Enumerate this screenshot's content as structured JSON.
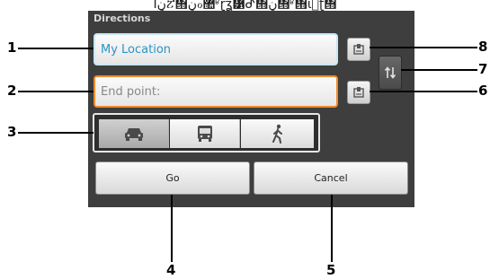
{
  "top_caption": "Ĭ݈ڼ݈ፘ፛͂ڼℴ޺ʶ̈ɽʓ᝱ᕸ፛ڼ፛ʶ፛ιᄌ̈ʈ፛",
  "dialog": {
    "title": "Directions",
    "start_field": {
      "value": "My Location"
    },
    "end_field": {
      "placeholder": "End point:"
    },
    "contact_icon_name": "contact-picker-icon",
    "swap_icon_name": "swap-arrows-icon",
    "transport_modes": [
      {
        "name": "car",
        "icon": "car-icon",
        "selected": true
      },
      {
        "name": "transit",
        "icon": "bus-icon",
        "selected": false
      },
      {
        "name": "walking",
        "icon": "walk-icon",
        "selected": false
      }
    ],
    "go_label": "Go",
    "cancel_label": "Cancel"
  },
  "callouts": {
    "c1": "1",
    "c2": "2",
    "c3": "3",
    "c4": "4",
    "c5": "5",
    "c6": "6",
    "c7": "7",
    "c8": "8"
  },
  "colors": {
    "panel": "#3e3e3e",
    "start_border": "#c9e7f4",
    "start_text": "#2a94c6",
    "end_border": "#f08b2a"
  }
}
